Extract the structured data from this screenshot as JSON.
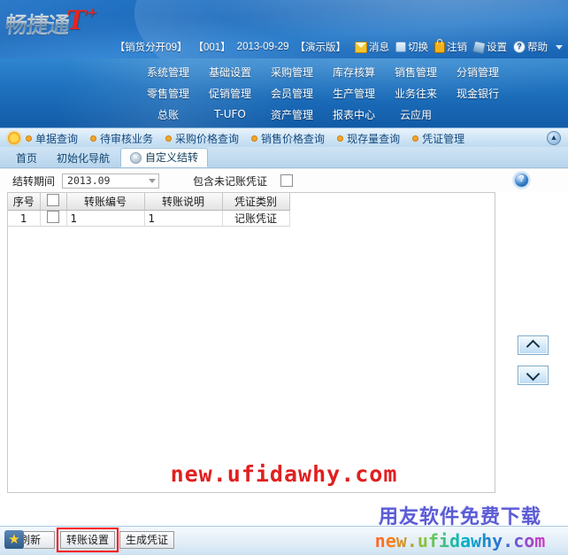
{
  "app": {
    "logo_cn": "畅捷通",
    "logo_tp": "T",
    "logo_plus": "+"
  },
  "header": {
    "account": "【销货分开09】",
    "operator": "【001】",
    "date": "2013-09-29",
    "edition": "【演示版】",
    "links": [
      {
        "label": "消息",
        "icon": "mail-icon"
      },
      {
        "label": "切换",
        "icon": "switch-icon"
      },
      {
        "label": "注销",
        "icon": "lock-icon"
      },
      {
        "label": "设置",
        "icon": "gear-icon"
      },
      {
        "label": "帮助",
        "icon": "help-icon"
      }
    ]
  },
  "menu": {
    "items": [
      "系统管理",
      "基础设置",
      "采购管理",
      "库存核算",
      "销售管理",
      "分销管理",
      "零售管理",
      "促销管理",
      "会员管理",
      "生产管理",
      "业务往来",
      "现金银行",
      "总账",
      "T-UFO",
      "资产管理",
      "报表中心",
      "云应用"
    ]
  },
  "quickbar": {
    "items": [
      "单据查询",
      "待审核业务",
      "采购价格查询",
      "销售价格查询",
      "现存量查询",
      "凭证管理"
    ],
    "collapse_icon": "collapse-up-icon"
  },
  "tabs": [
    {
      "label": "首页",
      "active": false,
      "closable": false
    },
    {
      "label": "初始化导航",
      "active": false,
      "closable": false
    },
    {
      "label": "自定义结转",
      "active": true,
      "closable": true
    }
  ],
  "filter": {
    "period_label": "结转期间",
    "period_value": "2013.09",
    "include_label": "包含未记账凭证",
    "include_checked": false,
    "help_icon": "help-circle-icon"
  },
  "grid": {
    "columns": [
      "序号",
      "",
      "转账编号",
      "转账说明",
      "凭证类别"
    ],
    "rows": [
      {
        "index": "1",
        "checked": false,
        "code": "1",
        "desc": "1",
        "type": "记账凭证"
      }
    ]
  },
  "sidebuttons": {
    "up": "move-up",
    "down": "move-down"
  },
  "bottom": {
    "buttons": [
      {
        "label": "刷新",
        "name": "refresh-button",
        "highlighted": false
      },
      {
        "label": "转账设置",
        "name": "transfer-settings-button",
        "highlighted": true
      },
      {
        "label": "生成凭证",
        "name": "generate-voucher-button",
        "highlighted": false
      }
    ],
    "star_icon": "star-icon"
  },
  "watermarks": {
    "center": "new.ufidawhy.com",
    "br_line1": "用友软件免费下载",
    "br_line2": "new.ufidawhy.com"
  },
  "colors": {
    "banner_blue": "#1667bb",
    "logo_red": "#e8241c",
    "highlight_red": "#ff0000",
    "watermark_red": "#e02020"
  }
}
